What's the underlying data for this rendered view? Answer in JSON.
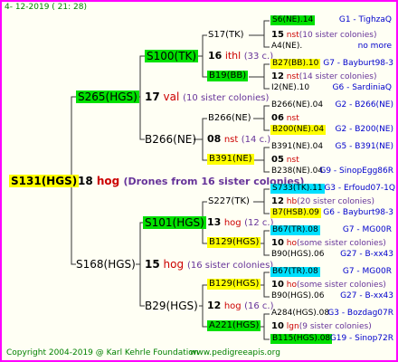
{
  "header": {
    "date": "4- 12-2019 ( 21: 28)"
  },
  "footer": {
    "copyright": "Copyright 2004-2019 @ Karl Kehrle Foundation",
    "site": "www.pedigreeapis.org"
  },
  "root": {
    "id": "S131(HGS)",
    "num": "18",
    "word": "hog",
    "note": "(Drones from 16 sister colonies)"
  },
  "gen1": [
    {
      "id": "S265(HGS)",
      "num": "17",
      "word": "val",
      "note": "(10 sister colonies)"
    },
    {
      "id": "S168(HGS)",
      "num": "15",
      "word": "hog",
      "note": "(16 sister colonies)"
    }
  ],
  "gen2": [
    {
      "id": "S100(TK)",
      "num": "16",
      "word": "ithl",
      "note": "(33 c.)"
    },
    {
      "id": "B266(NE)",
      "num": "08",
      "word": "nst",
      "note": "(14 c.)"
    },
    {
      "id": "S101(HGS)",
      "num": "13",
      "word": "hog",
      "note": "(12 c.)"
    },
    {
      "id": "B29(HGS)",
      "num": "12",
      "word": "hog",
      "note": "(16 c.)"
    }
  ],
  "gen3": [
    {
      "id": "S17(TK)",
      "num": "15",
      "word": "nst",
      "note": "(10 sister colonies)"
    },
    {
      "id": "B19(BB)",
      "num": "12",
      "word": "nst",
      "note": "(14 sister colonies)"
    },
    {
      "id": "B266(NE)",
      "num": "06",
      "word": "nst",
      "note": ""
    },
    {
      "id": "B391(NE)",
      "num": "05",
      "word": "nst",
      "note": ""
    },
    {
      "id": "S227(TK)",
      "num": "12",
      "word": "hb",
      "note": "(20 sister colonies)"
    },
    {
      "id": "B129(HGS)",
      "num": "10",
      "word": "ho",
      "note": "(some sister colonies)"
    },
    {
      "id": "B129(HGS)",
      "num": "10",
      "word": "ho",
      "note": "(some sister colonies)"
    },
    {
      "id": "A221(HGS)",
      "num": "10",
      "word": "lgn",
      "note": "(9 sister colonies)"
    }
  ],
  "gen4": [
    {
      "id": "S6(NE).14",
      "info": "G1 - TighzaQ"
    },
    {
      "id": "A4(NE).",
      "info": "no more"
    },
    {
      "id": "B27(BB).10",
      "info": "G7 - Bayburt98-3"
    },
    {
      "id": "I2(NE).10",
      "info": "G6 - SardiniaQ"
    },
    {
      "id": "B266(NE).04",
      "info": "G2 - B266(NE)"
    },
    {
      "id": "B200(NE).04",
      "info": "G2 - B200(NE)"
    },
    {
      "id": "B391(NE).04",
      "info": "G5 - B391(NE)"
    },
    {
      "id": "B238(NE).04",
      "info": "G9 - SinopEgg86R"
    },
    {
      "id": "S733(TK).11",
      "info": "G3 - Erfoud07-1Q"
    },
    {
      "id": "B7(HSB).09",
      "info": "G6 - Bayburt98-3"
    },
    {
      "id": "B67(TR).08",
      "info": "G7 - MG00R"
    },
    {
      "id": "B90(HGS).06",
      "info": "G27 - B-xx43"
    },
    {
      "id": "B67(TR).08",
      "info": "G7 - MG00R"
    },
    {
      "id": "B90(HGS).06",
      "info": "G27 - B-xx43"
    },
    {
      "id": "A284(HGS).08",
      "info": "G3 - Bozdag07R"
    },
    {
      "id": "B115(HGS).08",
      "info": "G19 - Sinop72R"
    }
  ]
}
